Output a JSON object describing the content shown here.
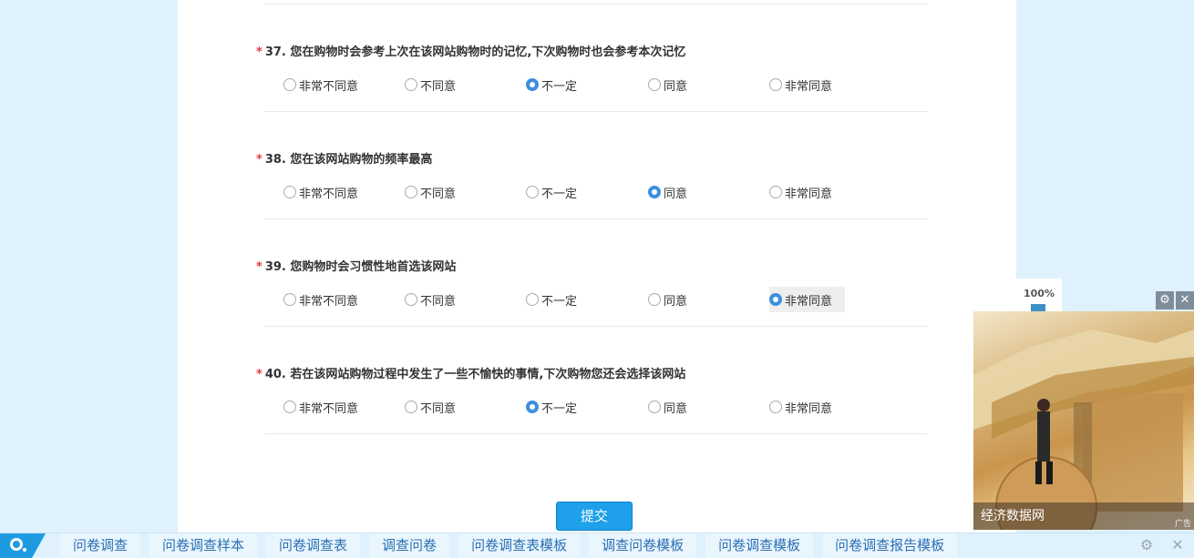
{
  "questions": [
    {
      "number": "37.",
      "text": "您在购物时会参考上次在该网站购物时的记忆,下次购物时也会参考本次记忆",
      "required_mark": "*",
      "options": [
        "非常不同意",
        "不同意",
        "不一定",
        "同意",
        "非常同意"
      ],
      "selected": "不一定"
    },
    {
      "number": "38.",
      "text": "您在该网站购物的频率最高",
      "required_mark": "*",
      "options": [
        "非常不同意",
        "不同意",
        "不一定",
        "同意",
        "非常同意"
      ],
      "selected": "同意"
    },
    {
      "number": "39.",
      "text": "您购物时会习惯性地首选该网站",
      "required_mark": "*",
      "options": [
        "非常不同意",
        "不同意",
        "不一定",
        "同意",
        "非常同意"
      ],
      "selected": "非常同意"
    },
    {
      "number": "40.",
      "text": "若在该网站购物过程中发生了一些不愉快的事情,下次购物您还会选择该网站",
      "required_mark": "*",
      "options": [
        "非常不同意",
        "不同意",
        "不一定",
        "同意",
        "非常同意"
      ],
      "selected": "不一定"
    }
  ],
  "submit_label": "提交",
  "progress": {
    "label": "100%",
    "value": 100
  },
  "ad": {
    "caption": "经济数据网",
    "tag": "广告",
    "settings_icon": "gear-icon",
    "close_icon": "close-icon"
  },
  "bottom_bar": {
    "links": [
      "问卷调查",
      "问卷调查样本",
      "问卷调查表",
      "调查问卷",
      "问卷调查表模板",
      "调查问卷模板",
      "问卷调查模板",
      "问卷调查报告模板"
    ],
    "settings_icon": "gear-icon",
    "close_icon": "close-icon"
  },
  "colors": {
    "accent": "#1ea0ea",
    "radio_checked": "#3d8fe0",
    "required": "#e4393c",
    "background": "#dff1fc"
  }
}
